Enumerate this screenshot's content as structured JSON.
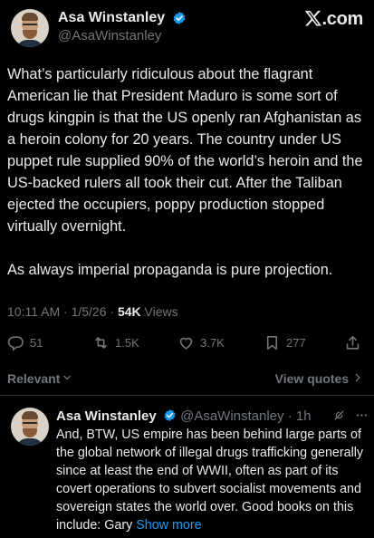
{
  "post": {
    "author_name": "Asa Winstanley",
    "author_handle": "@AsaWinstanley",
    "brand": ".com",
    "paragraph1": "What’s particularly ridiculous about the flagrant American lie that President Maduro is some sort of drugs kingpin is that the US openly ran Afghanistan as a heroin colony for 20 years. The country under US puppet rule supplied 90% of the world’s heroin and the US-backed rulers all took their cut. After the Taliban ejected the occupiers, poppy production stopped virtually overnight.",
    "paragraph2": "As always imperial propaganda is pure projection.",
    "time": "10:11 AM",
    "date": "1/5/26",
    "views_count": "54K",
    "views_label": "Views"
  },
  "actions": {
    "replies": "51",
    "reposts": "1.5K",
    "likes": "3.7K",
    "bookmarks": "277"
  },
  "sort": {
    "relevant_label": "Relevant",
    "view_quotes_label": "View quotes"
  },
  "reply": {
    "author_name": "Asa Winstanley",
    "author_handle": "@AsaWinstanley",
    "age": "1h",
    "text": "And, BTW, US empire has been behind large parts of the global network of illegal drugs trafficking generally since at least the end of WWII, often as part of its covert operations to subvert socialist movements and sovereign states the world over. Good books on this include: Gary",
    "show_more": "Show more"
  },
  "colors": {
    "background": "#000000",
    "text": "#e7e9ea",
    "muted": "#71767b",
    "accent": "#1d9bf0",
    "divider": "#2f3336"
  },
  "icons": [
    "verified-badge-icon",
    "x-logo-icon",
    "reply-icon",
    "repost-icon",
    "like-icon",
    "bookmark-icon",
    "share-icon",
    "chevron-down-icon",
    "chevron-right-icon",
    "grok-icon",
    "more-icon"
  ]
}
